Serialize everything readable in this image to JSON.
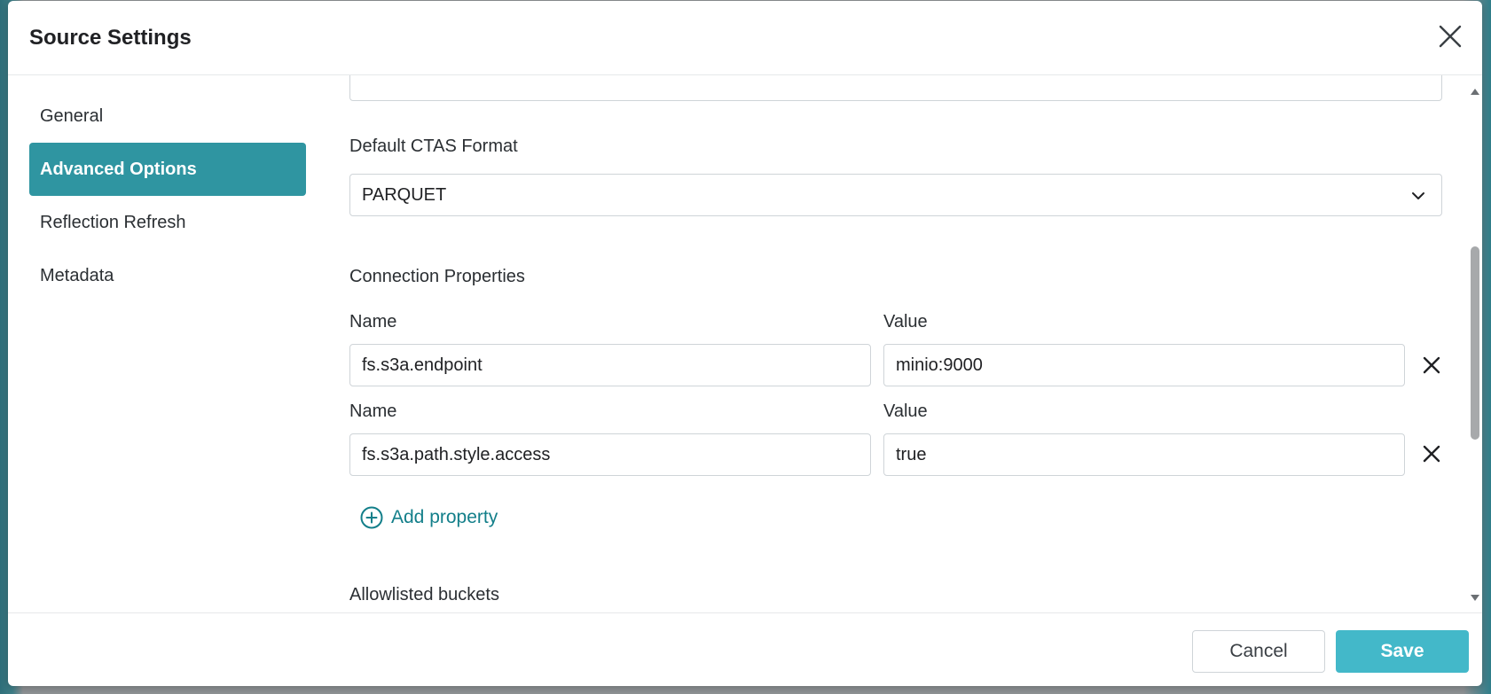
{
  "modal": {
    "title": "Source Settings"
  },
  "sidebar": {
    "items": [
      {
        "label": "General",
        "active": false
      },
      {
        "label": "Advanced Options",
        "active": true
      },
      {
        "label": "Reflection Refresh",
        "active": false
      },
      {
        "label": "Metadata",
        "active": false
      }
    ]
  },
  "main": {
    "ctas_format": {
      "label": "Default CTAS Format",
      "value": "PARQUET"
    },
    "connection_properties": {
      "heading": "Connection Properties",
      "rows": [
        {
          "name_label": "Name",
          "value_label": "Value",
          "name": "fs.s3a.endpoint",
          "value": "minio:9000"
        },
        {
          "name_label": "Name",
          "value_label": "Value",
          "name": "fs.s3a.path.style.access",
          "value": "true"
        }
      ],
      "add_label": "Add property"
    },
    "allowlisted_buckets": {
      "label": "Allowlisted buckets"
    }
  },
  "footer": {
    "cancel_label": "Cancel",
    "save_label": "Save"
  },
  "colors": {
    "accent": "#2f95a1",
    "save": "#43b8c9",
    "link": "#137f8a"
  },
  "icons": {
    "close": "close-icon",
    "chevron": "chevron-down-icon",
    "remove": "remove-icon",
    "add": "plus-circle-icon"
  }
}
